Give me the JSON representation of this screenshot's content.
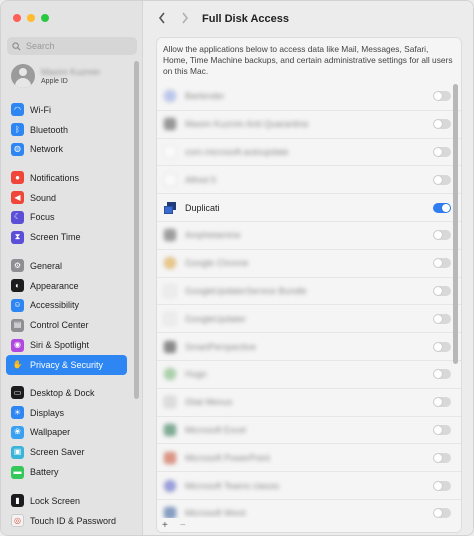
{
  "window": {
    "title": "Full Disk Access"
  },
  "search": {
    "placeholder": "Search"
  },
  "account": {
    "name": "Maxim Kuzmin",
    "subtitle": "Apple ID"
  },
  "sidebar": {
    "groups": [
      [
        {
          "name": "wifi",
          "label": "Wi-Fi",
          "icon": "wifi-icon",
          "color": "#2e86f3",
          "glyph": "◠"
        },
        {
          "name": "bluetooth",
          "label": "Bluetooth",
          "icon": "bluetooth-icon",
          "color": "#2e86f3",
          "glyph": "ᛒ"
        },
        {
          "name": "network",
          "label": "Network",
          "icon": "globe-icon",
          "color": "#2e86f3",
          "glyph": "◍"
        }
      ],
      [
        {
          "name": "notifications",
          "label": "Notifications",
          "icon": "bell-icon",
          "color": "#f0463a",
          "glyph": "●"
        },
        {
          "name": "sound",
          "label": "Sound",
          "icon": "speaker-icon",
          "color": "#f0463a",
          "glyph": "◀"
        },
        {
          "name": "focus",
          "label": "Focus",
          "icon": "moon-icon",
          "color": "#5b4fd8",
          "glyph": "☾"
        },
        {
          "name": "screen-time",
          "label": "Screen Time",
          "icon": "hourglass-icon",
          "color": "#5b4fd8",
          "glyph": "⧗"
        }
      ],
      [
        {
          "name": "general",
          "label": "General",
          "icon": "gear-icon",
          "color": "#8e8e93",
          "glyph": "⚙"
        },
        {
          "name": "appearance",
          "label": "Appearance",
          "icon": "appearance-icon",
          "color": "#1c1c1e",
          "glyph": "◐"
        },
        {
          "name": "accessibility",
          "label": "Accessibility",
          "icon": "accessibility-icon",
          "color": "#2e86f3",
          "glyph": "☺"
        },
        {
          "name": "control-center",
          "label": "Control Center",
          "icon": "control-center-icon",
          "color": "#8e8e93",
          "glyph": "▤"
        },
        {
          "name": "siri-spotlight",
          "label": "Siri & Spotlight",
          "icon": "siri-icon",
          "color": "#b048e0",
          "glyph": "◉"
        },
        {
          "name": "privacy-security",
          "label": "Privacy & Security",
          "icon": "hand-icon",
          "color": "#2e86f3",
          "glyph": "✋",
          "active": true
        }
      ],
      [
        {
          "name": "desktop-dock",
          "label": "Desktop & Dock",
          "icon": "dock-icon",
          "color": "#1c1c1e",
          "glyph": "▭"
        },
        {
          "name": "displays",
          "label": "Displays",
          "icon": "sun-icon",
          "color": "#2e86f3",
          "glyph": "☀"
        },
        {
          "name": "wallpaper",
          "label": "Wallpaper",
          "icon": "wallpaper-icon",
          "color": "#3aa0f2",
          "glyph": "❀"
        },
        {
          "name": "screen-saver",
          "label": "Screen Saver",
          "icon": "screen-saver-icon",
          "color": "#3ab4d8",
          "glyph": "▣"
        },
        {
          "name": "battery",
          "label": "Battery",
          "icon": "battery-icon",
          "color": "#34c759",
          "glyph": "▬"
        }
      ],
      [
        {
          "name": "lock-screen",
          "label": "Lock Screen",
          "icon": "lock-icon",
          "color": "#1c1c1e",
          "glyph": "▮"
        },
        {
          "name": "touch-id-password",
          "label": "Touch ID & Password",
          "icon": "fingerprint-icon",
          "color": "#f2f2f2",
          "glyph": "◎"
        }
      ]
    ]
  },
  "main": {
    "description": "Allow the applications below to access data like Mail, Messages, Safari, Home, Time Machine backups, and certain administrative settings for all users on this Mac.",
    "apps": [
      {
        "label": "Bartender",
        "icon_color": "#8fa3e8",
        "enabled": false,
        "blurred": true
      },
      {
        "label": "Maxim Kuzmin Anti Quarantine",
        "icon_color": "#4a4a4a",
        "enabled": false,
        "blurred": true
      },
      {
        "label": "com.microsoft.autoupdate",
        "icon_color": "#ffffff",
        "enabled": false,
        "blurred": true
      },
      {
        "label": "Alfred 5",
        "icon_color": "#ffffff",
        "enabled": false,
        "blurred": true
      },
      {
        "label": "Duplicati",
        "icon_color": "#1f3b7a",
        "enabled": true,
        "blurred": false
      },
      {
        "label": "Amphetamine",
        "icon_color": "#555555",
        "enabled": false,
        "blurred": true
      },
      {
        "label": "Google Chrome",
        "icon_color": "#e0a030",
        "enabled": false,
        "blurred": true
      },
      {
        "label": "GoogleUpdaterService Bundle",
        "icon_color": "#e6e6e6",
        "enabled": false,
        "blurred": true
      },
      {
        "label": "GoogleUpdater",
        "icon_color": "#e6e6e6",
        "enabled": false,
        "blurred": true
      },
      {
        "label": "SmartPerspective",
        "icon_color": "#333333",
        "enabled": false,
        "blurred": true
      },
      {
        "label": "Hugo",
        "icon_color": "#6db56d",
        "enabled": false,
        "blurred": true
      },
      {
        "label": "iStat Menus",
        "icon_color": "#c8c8c8",
        "enabled": false,
        "blurred": true
      },
      {
        "label": "Microsoft Excel",
        "icon_color": "#1e7145",
        "enabled": false,
        "blurred": true
      },
      {
        "label": "Microsoft PowerPoint",
        "icon_color": "#c84727",
        "enabled": false,
        "blurred": true
      },
      {
        "label": "Microsoft Teams classic",
        "icon_color": "#5058c8",
        "enabled": false,
        "blurred": true
      },
      {
        "label": "Microsoft Word",
        "icon_color": "#2b579a",
        "enabled": false,
        "blurred": true
      }
    ],
    "add_label": "+",
    "remove_label": "−"
  }
}
